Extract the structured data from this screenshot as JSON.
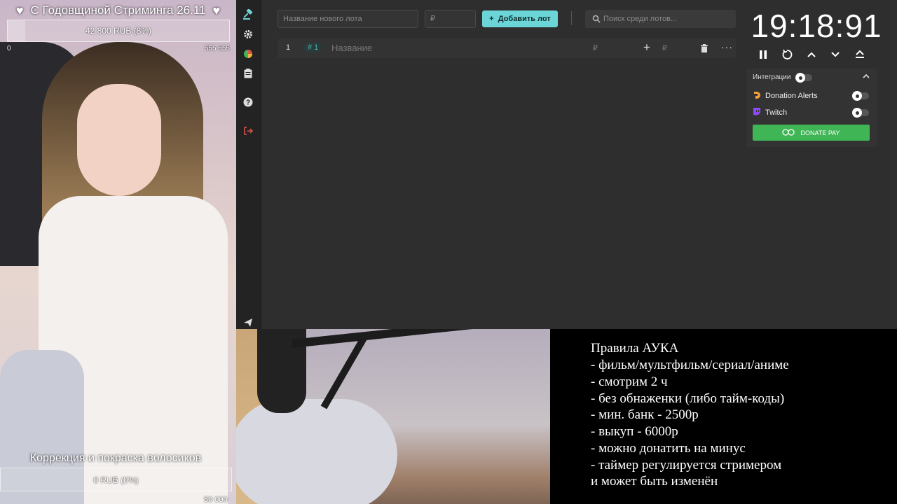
{
  "top_goal": {
    "title": "С Годовщиной Стриминга 26.11",
    "progress_text": "42 800 RUB (8%)",
    "progress_percent": 8,
    "min_label": "0",
    "max_label": "555 555"
  },
  "bottom_goal": {
    "title": "Коррекция и покраска волосиков",
    "progress_text": "0 RUB (0%)",
    "progress_percent": 0,
    "max_label": "50 000"
  },
  "toolbar": {
    "lot_name_placeholder": "Название нового лота",
    "lot_sum_placeholder": "₽",
    "add_lot_label": "Добавить лот",
    "search_placeholder": "Поиск среди лотов..."
  },
  "lots": [
    {
      "index": "1",
      "tag": "# 1",
      "name": "Название",
      "amount_symbol": "₽",
      "bid_symbol": "₽"
    }
  ],
  "timer": {
    "value": "19:18:91"
  },
  "integrations": {
    "title": "Интеграции",
    "items": [
      {
        "label": "Donation Alerts",
        "icon": "donation-alerts-icon"
      },
      {
        "label": "Twitch",
        "icon": "twitch-icon"
      }
    ],
    "donate_pay_label": "DONATE PAY"
  },
  "rules": {
    "lines": [
      "Правила АУКА",
      "- фильм/мультфильм/сериал/аниме",
      "- смотрим 2 ч",
      "- без обнаженки (либо тайм-коды)",
      "- мин. банк - 2500р",
      "- выкуп - 6000р",
      "- можно донатить на минус",
      "- таймер регулируется стримером",
      "и может быть изменён"
    ]
  },
  "colors": {
    "accent": "#6bd5d8",
    "donate_pay": "#3fb556",
    "app_bg": "#2b2b2b",
    "logout": "#e0564b"
  }
}
